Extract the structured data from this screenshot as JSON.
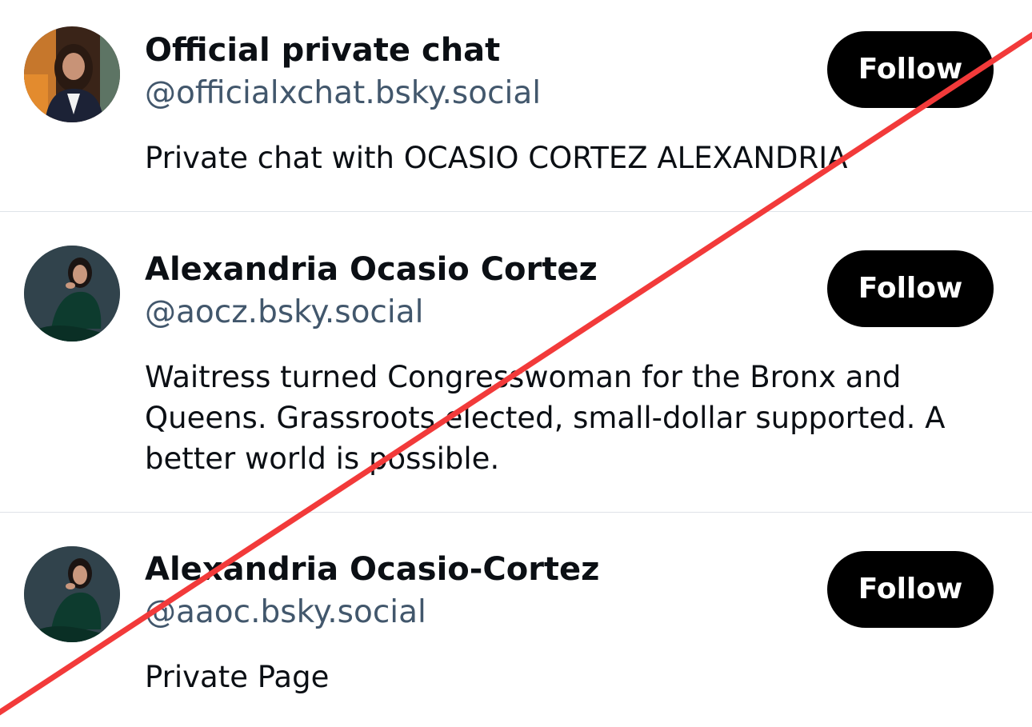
{
  "accounts": [
    {
      "name": "Official private chat",
      "handle": "@officialxchat.bsky.social",
      "bio": "Private chat with OCASIO CORTEZ ALEXANDRIA",
      "follow_label": "Follow"
    },
    {
      "name": "Alexandria Ocasio Cortez",
      "handle": "@aocz.bsky.social",
      "bio": "Waitress turned Congresswoman for the Bronx and Queens. Grassroots elected, small-dollar supported. A better world is possible.",
      "follow_label": "Follow"
    },
    {
      "name": "Alexandria Ocasio-Cortez",
      "handle": "@aaoc.bsky.social",
      "bio": "Private Page",
      "follow_label": "Follow"
    }
  ],
  "colors": {
    "handle": "#42576c",
    "button_bg": "#000000",
    "button_text": "#ffffff",
    "strike_line": "#f23a3a",
    "divider": "#dfe3e8"
  },
  "overlay": {
    "icon": "red-diagonal-strike-line"
  }
}
